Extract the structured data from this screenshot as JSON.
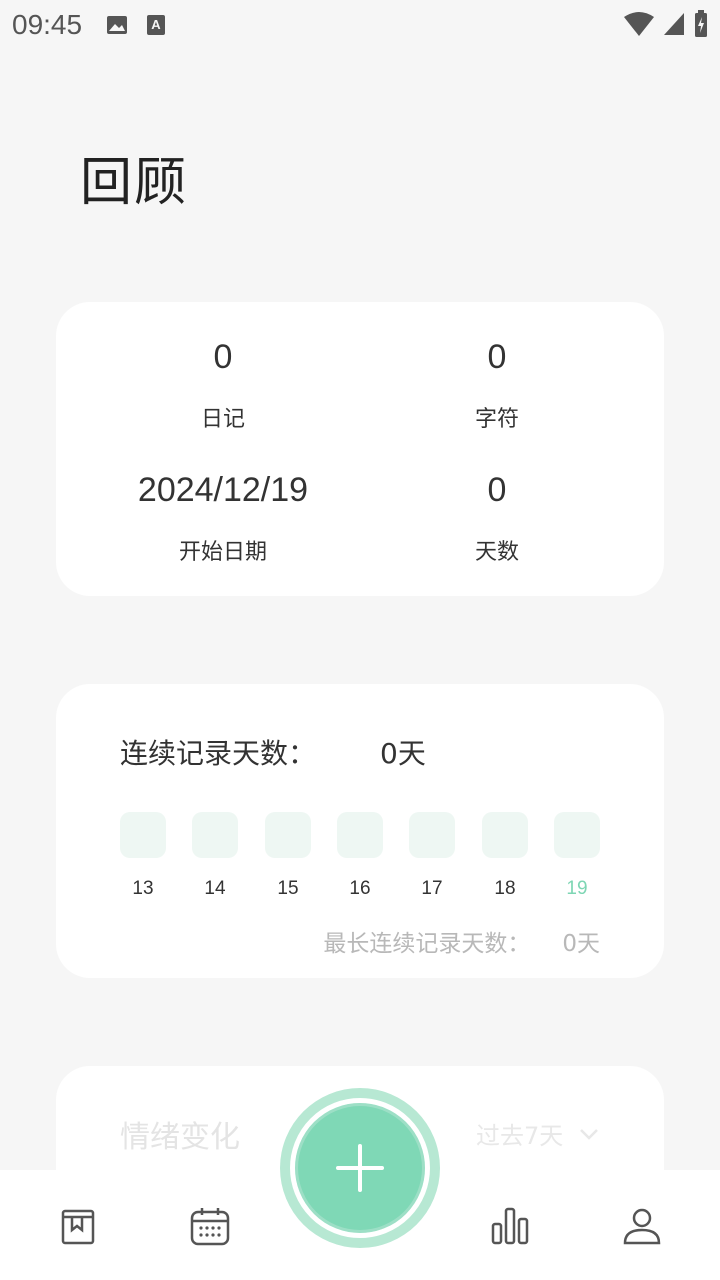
{
  "status_bar": {
    "time": "09:45",
    "icons": [
      "image-icon",
      "text-a-icon"
    ],
    "right_icons": [
      "wifi-icon",
      "signal-icon",
      "battery-charging-icon"
    ]
  },
  "page": {
    "title": "回顾"
  },
  "stats": {
    "diary_count": "0",
    "diary_label": "日记",
    "char_count": "0",
    "char_label": "字符",
    "start_date": "2024/12/19",
    "start_label": "开始日期",
    "days_count": "0",
    "days_label": "天数"
  },
  "streak": {
    "title": "连续记录天数：",
    "value": "0天",
    "days": [
      "13",
      "14",
      "15",
      "16",
      "17",
      "18",
      "19"
    ],
    "today_index": 6,
    "longest_label": "最长连续记录天数：",
    "longest_value": "0天"
  },
  "mood": {
    "title": "情绪变化",
    "range": "过去7天"
  },
  "colors": {
    "accent": "#7fd8b6",
    "accent_light": "#b7e8d3",
    "day_box": "#eef7f3",
    "today_text": "#7ed6b4"
  },
  "nav": {
    "items": [
      "diary-book-icon",
      "calendar-icon",
      "add-icon",
      "bar-chart-icon",
      "profile-icon"
    ]
  }
}
